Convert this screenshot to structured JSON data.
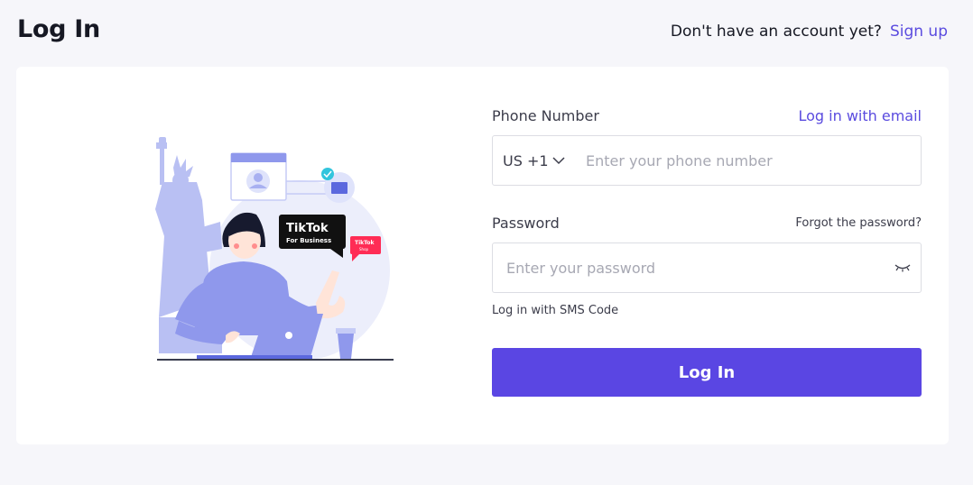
{
  "header": {
    "title": "Log In",
    "signup_prompt": "Don't have an account yet?",
    "signup_link": "Sign up"
  },
  "illustration": {
    "badge_brand": "TikTok",
    "badge_sub": "For Business",
    "shop_badge_brand": "TikTok",
    "shop_badge_sub": "Shop"
  },
  "form": {
    "phone_label": "Phone Number",
    "email_login_link": "Log in with email",
    "country_code": "US +1",
    "phone_placeholder": "Enter your phone number",
    "password_label": "Password",
    "forgot_link": "Forgot the password?",
    "password_placeholder": "Enter your password",
    "sms_link": "Log in with SMS Code",
    "submit_label": "Log In"
  },
  "colors": {
    "accent": "#5a46e3",
    "link": "#5a4bdf",
    "background": "#f6f6fa"
  },
  "icons": [
    "chevron-down-icon",
    "eye-closed-icon"
  ]
}
